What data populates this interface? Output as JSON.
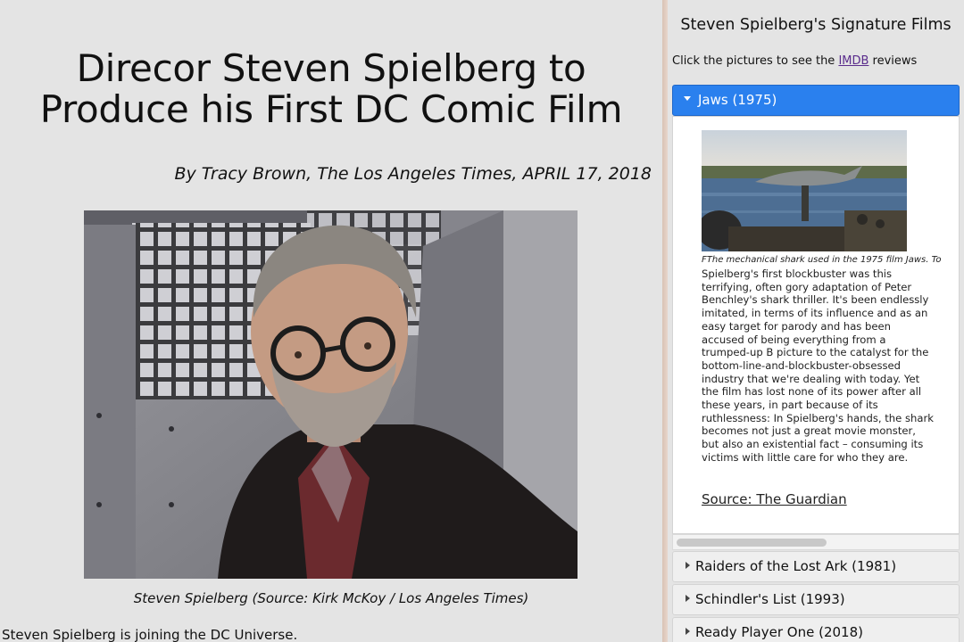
{
  "article": {
    "headline": "Direcor Steven Spielberg to Produce his First DC Comic Film",
    "byline": "By Tracy Brown, The Los Angeles Times, APRIL 17, 2018",
    "photo_caption": "Steven Spielberg (Source: Kirk McKoy / Los Angeles Times)",
    "body_first_line": "Steven Spielberg is joining the DC Universe."
  },
  "sidebar": {
    "title": "Steven Spielberg's Signature Films",
    "instruction_prefix": "Click the pictures to see the ",
    "instruction_link": "IMDB",
    "instruction_suffix": " reviews",
    "accordion": [
      {
        "label": "Jaws (1975)",
        "expanded": true,
        "image_caption": "FThe mechanical shark used in the 1975 film Jaws. To",
        "text": "Spielberg's first blockbuster was this terrifying, often gory adaptation of Peter Benchley's shark thriller. It's been endlessly imitated, in terms of its influence and as an easy target for parody and has been accused of being everything from a trumped-up B picture to the catalyst for the bottom-line-and-blockbuster-obsessed industry that we're dealing with today. Yet the film has lost none of its power after all these years, in part because of its ruthlessness: In Spielberg's hands, the shark becomes not just a great movie monster, but also an existential fact – consuming its victims with little care for who they are.",
        "source": "Source: The Guardian"
      },
      {
        "label": "Raiders of the Lost Ark (1981)",
        "expanded": false
      },
      {
        "label": "Schindler's List (1993)",
        "expanded": false
      },
      {
        "label": "Ready Player One (2018)",
        "expanded": false
      }
    ]
  },
  "colors": {
    "page_bg": "#e4e4e4",
    "accordion_active": "#2a80ee",
    "accordion_inactive": "#efefef",
    "link_visited": "#5a2c8c",
    "divider": "#d9c2b4"
  }
}
